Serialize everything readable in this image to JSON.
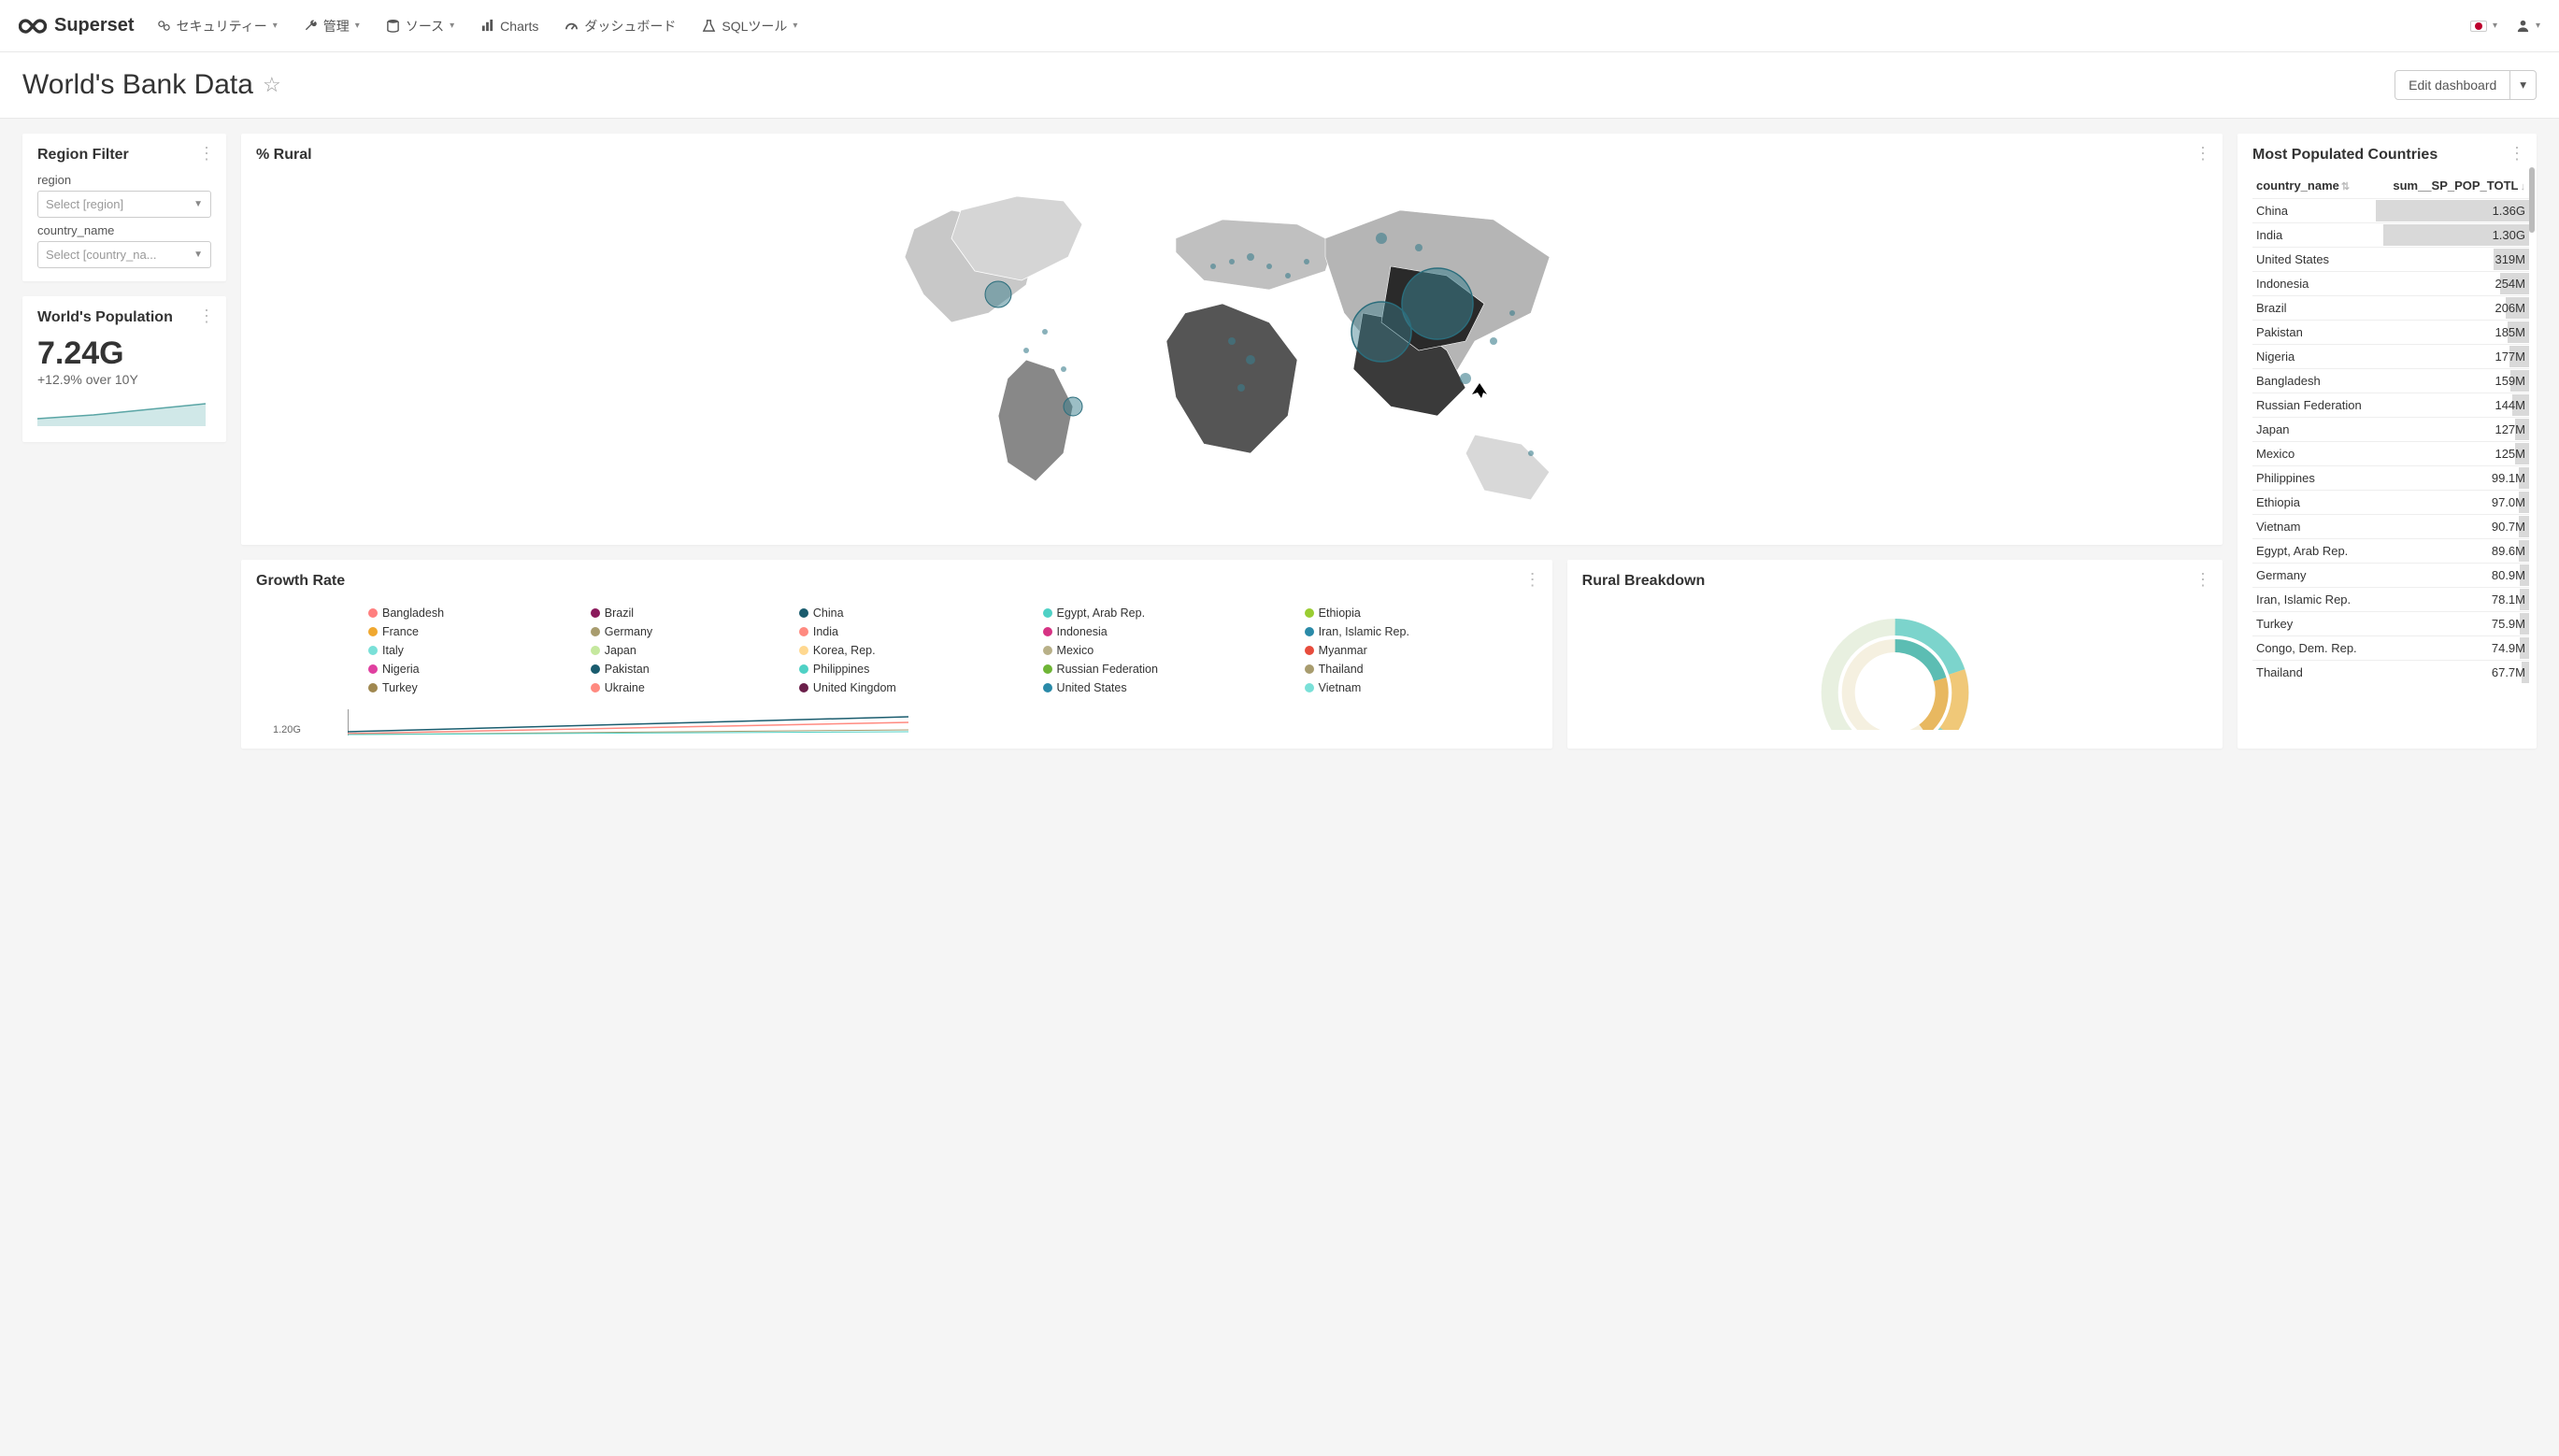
{
  "brand": "Superset",
  "nav": {
    "security": "セキュリティー",
    "manage": "管理",
    "source": "ソース",
    "charts": "Charts",
    "dashboard": "ダッシュボード",
    "sql": "SQLツール"
  },
  "header": {
    "title": "World's Bank Data",
    "edit": "Edit dashboard"
  },
  "filter": {
    "title": "Region Filter",
    "region_label": "region",
    "region_placeholder": "Select [region]",
    "country_label": "country_name",
    "country_placeholder": "Select [country_na..."
  },
  "population": {
    "title": "World's Population",
    "value": "7.24G",
    "delta": "+12.9% over 10Y"
  },
  "rural_map": {
    "title": "% Rural"
  },
  "growth": {
    "title": "Growth Rate",
    "y_tick": "1.20G",
    "legend": [
      {
        "label": "Bangladesh",
        "color": "#ff7f7f"
      },
      {
        "label": "Brazil",
        "color": "#8b1a5c"
      },
      {
        "label": "China",
        "color": "#1a5c6e"
      },
      {
        "label": "Egypt, Arab Rep.",
        "color": "#4fd1c5"
      },
      {
        "label": "Ethiopia",
        "color": "#9acd32"
      },
      {
        "label": "France",
        "color": "#f0a830"
      },
      {
        "label": "Germany",
        "color": "#a89c6e"
      },
      {
        "label": "India",
        "color": "#ff8a80"
      },
      {
        "label": "Indonesia",
        "color": "#d63384"
      },
      {
        "label": "Iran, Islamic Rep.",
        "color": "#2a8aa8"
      },
      {
        "label": "Italy",
        "color": "#7ae0d8"
      },
      {
        "label": "Japan",
        "color": "#c5e89e"
      },
      {
        "label": "Korea, Rep.",
        "color": "#ffd890"
      },
      {
        "label": "Mexico",
        "color": "#b8b088"
      },
      {
        "label": "Myanmar",
        "color": "#e74c3c"
      },
      {
        "label": "Nigeria",
        "color": "#e040a0"
      },
      {
        "label": "Pakistan",
        "color": "#1a5c6e"
      },
      {
        "label": "Philippines",
        "color": "#4fd1c5"
      },
      {
        "label": "Russian Federation",
        "color": "#6fb536"
      },
      {
        "label": "Thailand",
        "color": "#a89c6e"
      },
      {
        "label": "Turkey",
        "color": "#a08850"
      },
      {
        "label": "Ukraine",
        "color": "#ff8a80"
      },
      {
        "label": "United Kingdom",
        "color": "#6b1f4a"
      },
      {
        "label": "United States",
        "color": "#2a8aa8"
      },
      {
        "label": "Vietnam",
        "color": "#7ae0d8"
      }
    ]
  },
  "rural_breakdown": {
    "title": "Rural Breakdown"
  },
  "countries_table": {
    "title": "Most Populated Countries",
    "col_name": "country_name",
    "col_pop": "sum__SP_POP_TOTL",
    "rows": [
      {
        "name": "China",
        "value": "1.36G",
        "bar": 100
      },
      {
        "name": "India",
        "value": "1.30G",
        "bar": 95
      },
      {
        "name": "United States",
        "value": "319M",
        "bar": 23
      },
      {
        "name": "Indonesia",
        "value": "254M",
        "bar": 19
      },
      {
        "name": "Brazil",
        "value": "206M",
        "bar": 15
      },
      {
        "name": "Pakistan",
        "value": "185M",
        "bar": 14
      },
      {
        "name": "Nigeria",
        "value": "177M",
        "bar": 13
      },
      {
        "name": "Bangladesh",
        "value": "159M",
        "bar": 12
      },
      {
        "name": "Russian Federation",
        "value": "144M",
        "bar": 11
      },
      {
        "name": "Japan",
        "value": "127M",
        "bar": 9
      },
      {
        "name": "Mexico",
        "value": "125M",
        "bar": 9
      },
      {
        "name": "Philippines",
        "value": "99.1M",
        "bar": 7
      },
      {
        "name": "Ethiopia",
        "value": "97.0M",
        "bar": 7
      },
      {
        "name": "Vietnam",
        "value": "90.7M",
        "bar": 7
      },
      {
        "name": "Egypt, Arab Rep.",
        "value": "89.6M",
        "bar": 7
      },
      {
        "name": "Germany",
        "value": "80.9M",
        "bar": 6
      },
      {
        "name": "Iran, Islamic Rep.",
        "value": "78.1M",
        "bar": 6
      },
      {
        "name": "Turkey",
        "value": "75.9M",
        "bar": 6
      },
      {
        "name": "Congo, Dem. Rep.",
        "value": "74.9M",
        "bar": 6
      },
      {
        "name": "Thailand",
        "value": "67.7M",
        "bar": 5
      }
    ]
  },
  "chart_data": [
    {
      "type": "table",
      "title": "Most Populated Countries",
      "columns": [
        "country_name",
        "sum__SP_POP_TOTL"
      ],
      "rows": [
        [
          "China",
          "1.36G"
        ],
        [
          "India",
          "1.30G"
        ],
        [
          "United States",
          "319M"
        ],
        [
          "Indonesia",
          "254M"
        ],
        [
          "Brazil",
          "206M"
        ],
        [
          "Pakistan",
          "185M"
        ],
        [
          "Nigeria",
          "177M"
        ],
        [
          "Bangladesh",
          "159M"
        ],
        [
          "Russian Federation",
          "144M"
        ],
        [
          "Japan",
          "127M"
        ],
        [
          "Mexico",
          "125M"
        ],
        [
          "Philippines",
          "99.1M"
        ],
        [
          "Ethiopia",
          "97.0M"
        ],
        [
          "Vietnam",
          "90.7M"
        ],
        [
          "Egypt, Arab Rep.",
          "89.6M"
        ],
        [
          "Germany",
          "80.9M"
        ],
        [
          "Iran, Islamic Rep.",
          "78.1M"
        ],
        [
          "Turkey",
          "75.9M"
        ],
        [
          "Congo, Dem. Rep.",
          "74.9M"
        ],
        [
          "Thailand",
          "67.7M"
        ]
      ]
    },
    {
      "type": "bignumber",
      "title": "World's Population",
      "value": 7240000000,
      "display": "7.24G",
      "delta_text": "+12.9% over 10Y"
    },
    {
      "type": "line",
      "title": "Growth Rate",
      "ylabel": "",
      "y_ticks": [
        "1.20G"
      ],
      "series": [
        "Bangladesh",
        "Brazil",
        "China",
        "Egypt, Arab Rep.",
        "Ethiopia",
        "France",
        "Germany",
        "India",
        "Indonesia",
        "Iran, Islamic Rep.",
        "Italy",
        "Japan",
        "Korea, Rep.",
        "Mexico",
        "Myanmar",
        "Nigeria",
        "Pakistan",
        "Philippines",
        "Russian Federation",
        "Thailand",
        "Turkey",
        "Ukraine",
        "United Kingdom",
        "United States",
        "Vietnam"
      ]
    },
    {
      "type": "map",
      "title": "% Rural",
      "encoding": "choropleth + bubble (population)"
    },
    {
      "type": "pie",
      "title": "Rural Breakdown",
      "style": "sunburst"
    }
  ]
}
